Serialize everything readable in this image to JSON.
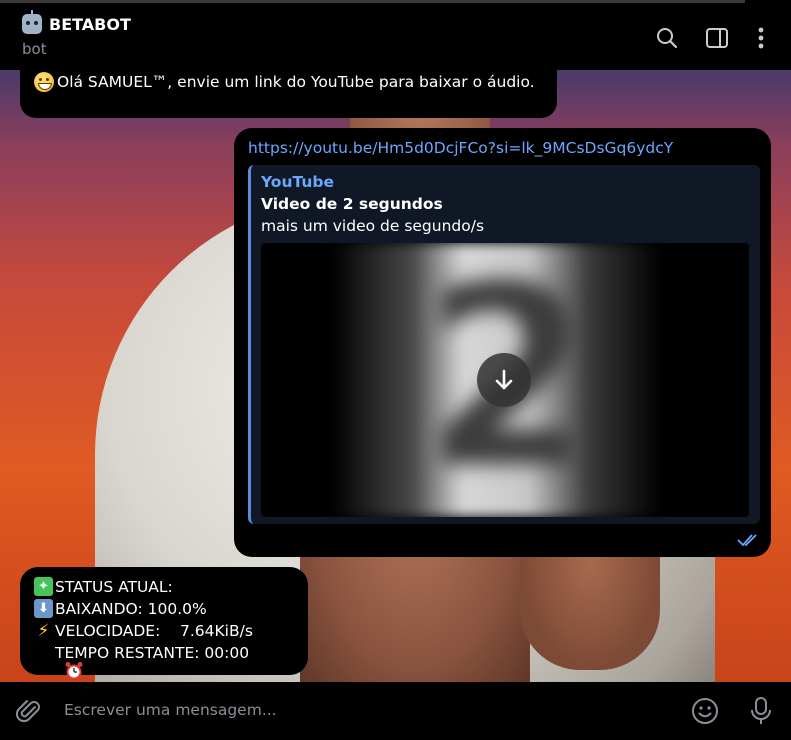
{
  "header": {
    "title": "BETABOT",
    "subtitle": "bot",
    "icons": [
      "search-icon",
      "sidebar-toggle-icon",
      "more-vertical-icon"
    ]
  },
  "messages": {
    "welcome": {
      "text": "Olá SAMUEL™, envie um link do YouTube para baixar o áudio."
    },
    "link_message": {
      "url": "https://youtu.be/Hm5d0DcjFCo?si=lk_9MCsDsGq6ydcY",
      "preview": {
        "site": "YouTube",
        "title": "Video de 2 segundos",
        "description": "mais um video de segundo/s"
      }
    },
    "status": {
      "line1": "STATUS ATUAL:",
      "line2": "BAIXANDO: 100.0%",
      "line3": "VELOCIDADE:    7.64KiB/s",
      "line4": "TEMPO RESTANTE: 00:00"
    }
  },
  "composer": {
    "placeholder": "Escrever uma mensagem..."
  },
  "colors": {
    "link": "#6aa7ff",
    "accent_bar": "#5a8bd8",
    "bubble_bg": "#000000",
    "muted_text": "#8b8f95"
  }
}
